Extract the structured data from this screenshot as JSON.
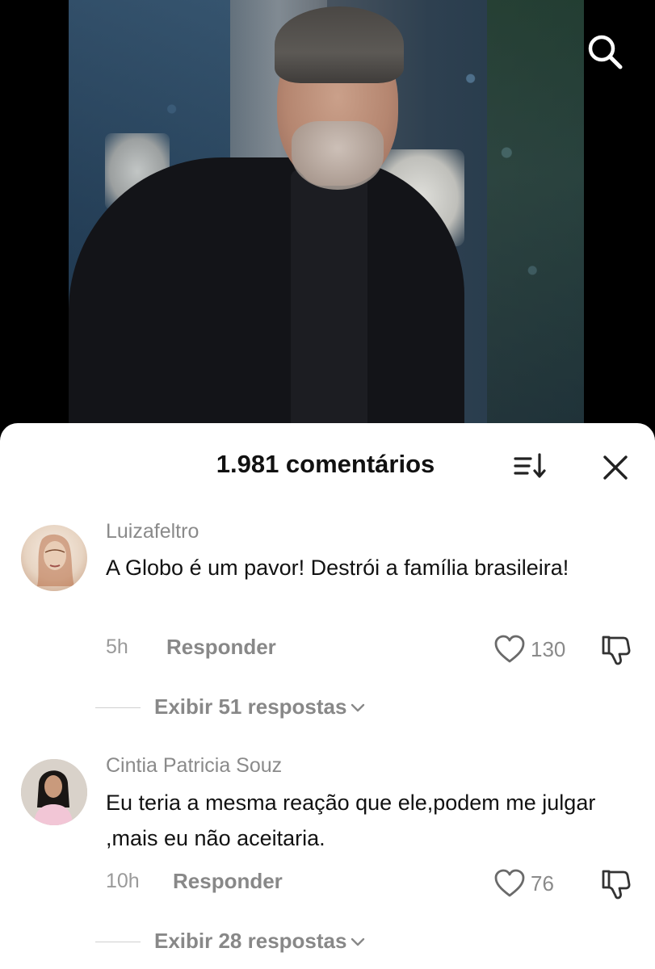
{
  "header": {
    "comment_count": "1.981 comentários"
  },
  "comments": [
    {
      "author": "Luizafeltro",
      "text": "A Globo é um pavor! Destrói a família brasileira!",
      "time": "5h",
      "reply_label": "Responder",
      "likes": "130",
      "view_replies": "Exibir 51 respostas"
    },
    {
      "author": "Cintia Patricia Souz",
      "text": "Eu teria a mesma reação que ele,podem me julgar ,mais eu não aceitaria.",
      "time": "10h",
      "reply_label": "Responder",
      "likes": "76",
      "view_replies": "Exibir 28 respostas"
    }
  ],
  "icons": {
    "search": "search-icon",
    "sort": "sort-icon",
    "close": "close-icon",
    "like": "heart-icon",
    "dislike": "thumbs-down-icon",
    "expand": "chevron-down-icon"
  }
}
